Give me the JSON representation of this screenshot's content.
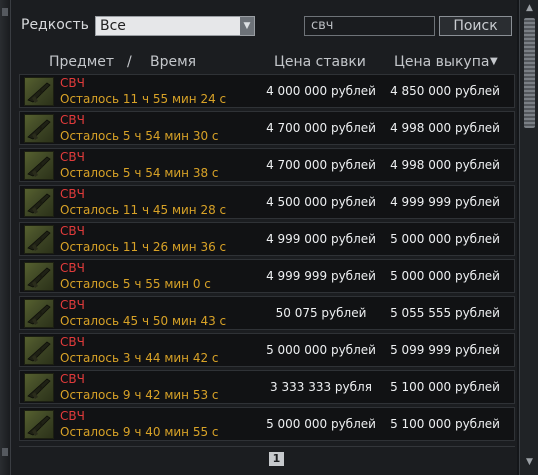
{
  "filters": {
    "rarity_label": "Редкость",
    "rarity_value": "Все",
    "search_value": "свч",
    "search_button": "Поиск"
  },
  "header": {
    "item": "Предмет",
    "separator": "/",
    "time": "Время",
    "bid": "Цена ставки",
    "buyout": "Цена выкупа",
    "sort_indicator": "▼"
  },
  "rows": [
    {
      "name": "СВЧ",
      "time": "Осталось 11 ч 55 мин 24 с",
      "bid": "4 000 000 рублей",
      "buyout": "4 850 000 рублей"
    },
    {
      "name": "СВЧ",
      "time": "Осталось 5 ч 54 мин 30 с",
      "bid": "4 700 000 рублей",
      "buyout": "4 998 000 рублей"
    },
    {
      "name": "СВЧ",
      "time": "Осталось 5 ч 54 мин 38 с",
      "bid": "4 700 000 рублей",
      "buyout": "4 998 000 рублей"
    },
    {
      "name": "СВЧ",
      "time": "Осталось 11 ч 45 мин 28 с",
      "bid": "4 500 000 рублей",
      "buyout": "4 999 999 рублей"
    },
    {
      "name": "СВЧ",
      "time": "Осталось 11 ч 26 мин 36 с",
      "bid": "4 999 000 рублей",
      "buyout": "5 000 000 рублей"
    },
    {
      "name": "СВЧ",
      "time": "Осталось 5 ч 55 мин 0 с",
      "bid": "4 999 999 рублей",
      "buyout": "5 000 000 рублей"
    },
    {
      "name": "СВЧ",
      "time": "Осталось 45 ч 50 мин 43 с",
      "bid": "50 075 рублей",
      "buyout": "5 055 555 рублей"
    },
    {
      "name": "СВЧ",
      "time": "Осталось 3 ч 44 мин 42 с",
      "bid": "5 000 000 рублей",
      "buyout": "5 099 999 рублей"
    },
    {
      "name": "СВЧ",
      "time": "Осталось 9 ч 42 мин 53 с",
      "bid": "3 333 333 рубля",
      "buyout": "5 100 000 рублей"
    },
    {
      "name": "СВЧ",
      "time": "Осталось 9 ч 40 мин 55 с",
      "bid": "5 000 000 рублей",
      "buyout": "5 100 000 рублей"
    }
  ],
  "pager": {
    "current_page": "1"
  },
  "icons": {
    "item": "rifle-icon",
    "dropdown": "chevron-down-icon",
    "scroll_up": "arrow-up-icon",
    "scroll_down": "arrow-down-icon"
  },
  "colors": {
    "item_name": "#e23b3b",
    "time_left": "#d8a227",
    "price": "#eef0f2",
    "background": "#1b1d20"
  }
}
